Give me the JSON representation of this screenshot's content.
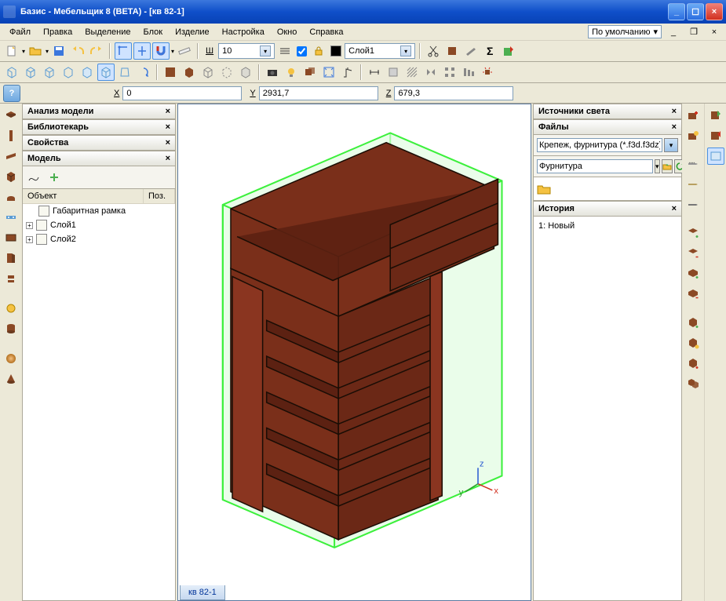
{
  "title": "Базис - Мебельщик 8 (BETA) - [кв 82-1]",
  "menu": [
    "Файл",
    "Правка",
    "Выделение",
    "Блок",
    "Изделие",
    "Настройка",
    "Окно",
    "Справка"
  ],
  "defaultScheme": "По умолчанию",
  "lineWidth": {
    "label": "Ш",
    "value": "10"
  },
  "layer": "Слой1",
  "coords": {
    "x": "0",
    "y": "2931,7",
    "z": "679,3"
  },
  "panels": {
    "analysis": "Анализ модели",
    "librarian": "Библиотекарь",
    "props": "Свойства",
    "model": "Модель"
  },
  "tree": {
    "col1": "Объект",
    "col2": "Поз.",
    "root": "Габаритная рамка",
    "l1": "Слой1",
    "l2": "Слой2"
  },
  "tab": "кв 82-1",
  "right": {
    "lights": "Источники света",
    "files": "Файлы",
    "filter": "Крепеж, фурнитура (*.f3d.f3dz)",
    "category": "Фурнитура",
    "history": "История",
    "hrow": "1: Новый"
  }
}
